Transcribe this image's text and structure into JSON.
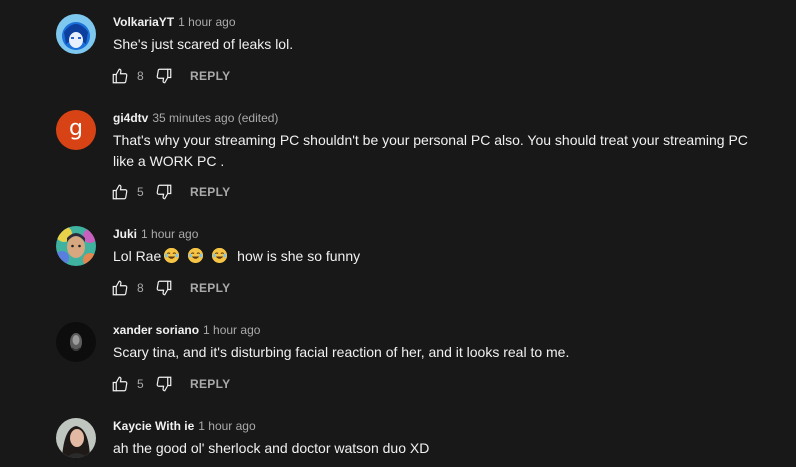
{
  "comments": [
    {
      "author": "VolkariaYT",
      "time": "1 hour ago",
      "text": "She's just scared of leaks lol.",
      "likes": "8",
      "reply": "REPLY",
      "avatar": "anime-avatar"
    },
    {
      "author": "gi4dtv",
      "time": "35 minutes ago (edited)",
      "text_line1": "That's why your streaming PC shouldn't be your personal PC also. You should treat your streaming PC",
      "text_line2": "like a WORK PC .",
      "likes": "5",
      "reply": "REPLY",
      "avatar_letter": "g",
      "avatar_color": "#d84315"
    },
    {
      "author": "Juki",
      "time": "1 hour ago",
      "text_prefix": "Lol Rae",
      "text_suffix": "how is she so funny",
      "emoji": "laughing-emoji",
      "likes": "8",
      "reply": "REPLY"
    },
    {
      "author": "xander soriano",
      "time": "1 hour ago",
      "text": "Scary tina, and it's disturbing facial reaction of her, and it looks real to me.",
      "likes": "5",
      "reply": "REPLY"
    },
    {
      "author": "Kaycie With ie",
      "time": "1 hour ago",
      "text": "ah the good ol' sherlock and doctor watson duo XD"
    }
  ],
  "colors": {
    "background": "#181818",
    "text": "#f1f1f1",
    "secondary": "#aaaaaa"
  }
}
